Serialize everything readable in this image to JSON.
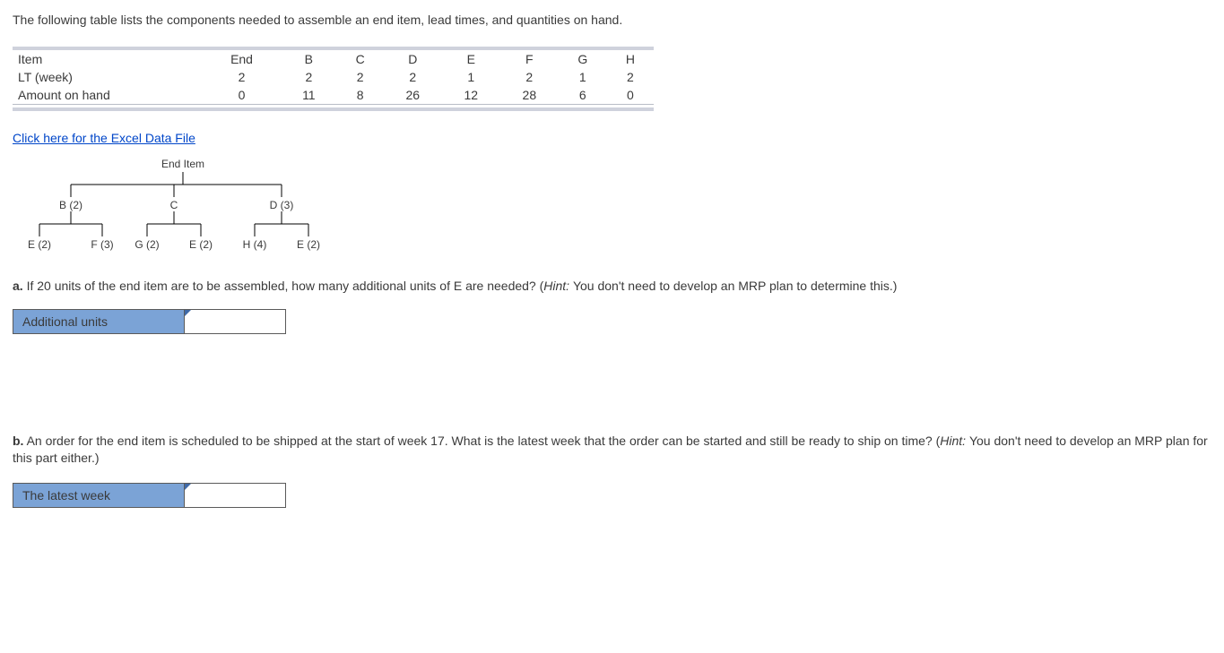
{
  "intro": "The following table lists the components needed to assemble an end item, lead times, and quantities on hand.",
  "table": {
    "rows": [
      {
        "label": "Item",
        "cells": [
          "End",
          "B",
          "C",
          "D",
          "E",
          "F",
          "G",
          "H"
        ]
      },
      {
        "label": "LT (week)",
        "cells": [
          "2",
          "2",
          "2",
          "2",
          "1",
          "2",
          "1",
          "2"
        ]
      },
      {
        "label": "Amount on hand",
        "cells": [
          "0",
          "11",
          "8",
          "26",
          "12",
          "28",
          "6",
          "0"
        ]
      }
    ]
  },
  "link_text": "Click here for the Excel Data File",
  "tree": {
    "root": "End Item",
    "level1": [
      "B (2)",
      "C",
      "D (3)"
    ],
    "level2": [
      "E (2)",
      "F (3)",
      "G (2)",
      "E (2)",
      "H (4)",
      "E (2)"
    ]
  },
  "part_a": {
    "label": "a.",
    "text": "If 20 units of the end item are to be assembled, how many additional units of E are needed? (",
    "hint_lead": "Hint: ",
    "hint_tail": "You don't need to develop an MRP plan to determine this.)",
    "answer_label": "Additional units"
  },
  "part_b": {
    "label": "b.",
    "text": "An order for the end item is scheduled to be shipped at the start of week 17. What is the latest week that the order can be started and still be ready to ship on time? (",
    "hint_lead": "Hint: ",
    "hint_tail": "You don't need to develop an MRP plan for this part either.)",
    "answer_label": "The latest week"
  }
}
